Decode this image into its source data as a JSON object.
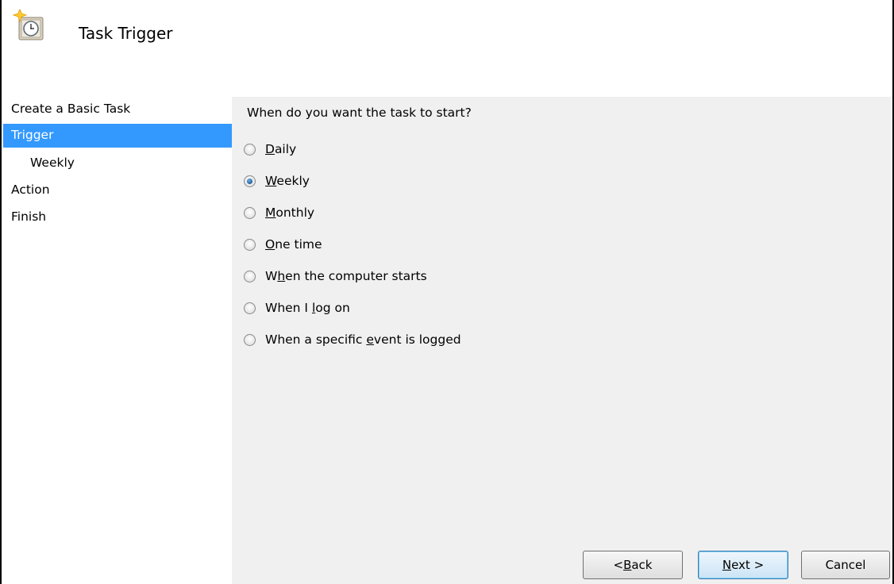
{
  "header": {
    "title": "Task Trigger",
    "icon": "scheduled-task-clock-icon"
  },
  "sidebar": {
    "items": [
      {
        "label": "Create a Basic Task"
      },
      {
        "label": "Trigger",
        "active": true
      },
      {
        "label": "Weekly",
        "sub": true
      },
      {
        "label": "Action"
      },
      {
        "label": "Finish"
      }
    ]
  },
  "main": {
    "question": "When do you want the task to start?",
    "selected": "Weekly",
    "options": [
      {
        "pre": "",
        "key": "D",
        "post": "aily"
      },
      {
        "pre": "",
        "key": "W",
        "post": "eekly"
      },
      {
        "pre": "",
        "key": "M",
        "post": "onthly"
      },
      {
        "pre": "",
        "key": "O",
        "post": "ne time"
      },
      {
        "pre": "W",
        "key": "h",
        "post": "en the computer starts"
      },
      {
        "pre": "When I ",
        "key": "l",
        "post": "og on"
      },
      {
        "pre": "When a specific ",
        "key": "e",
        "post": "vent is logged"
      }
    ]
  },
  "buttons": {
    "back": {
      "pre": "< ",
      "key": "B",
      "post": "ack"
    },
    "next": {
      "pre": "",
      "key": "N",
      "post": "ext >"
    },
    "cancel": "Cancel"
  },
  "colors": {
    "selection": "#3399ff",
    "panel_bg": "#f0f0f0"
  }
}
